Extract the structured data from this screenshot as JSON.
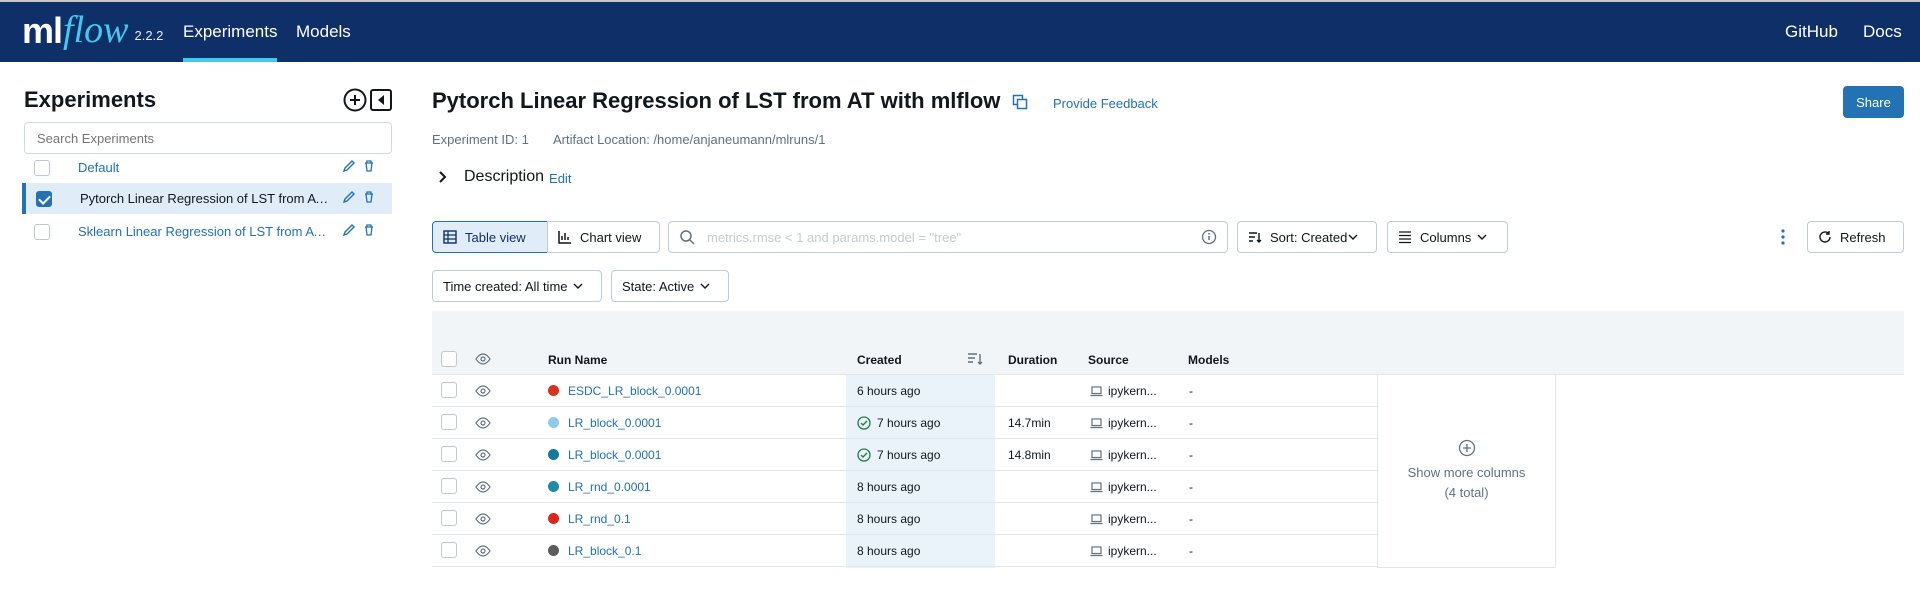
{
  "topbar": {
    "brand_ml": "ml",
    "brand_flow": "flow",
    "version": "2.2.2",
    "nav": {
      "experiments": "Experiments",
      "models": "Models",
      "github": "GitHub",
      "docs": "Docs"
    }
  },
  "sidebar": {
    "title": "Experiments",
    "search_placeholder": "Search Experiments",
    "experiments": [
      {
        "name": "Default",
        "checked": false
      },
      {
        "name": "Pytorch Linear Regression of LST from AT with mlflow",
        "checked": true
      },
      {
        "name": "Sklearn Linear Regression of LST from AT with mlflow",
        "checked": false
      }
    ]
  },
  "main": {
    "title": "Pytorch Linear Regression of LST from AT with mlflow",
    "feedback": "Provide Feedback",
    "share": "Share",
    "experiment_id": "Experiment ID: 1",
    "artifact_location": "Artifact Location: /home/anjaneumann/mlruns/1",
    "description_label": "Description",
    "description_edit": "Edit",
    "toolbar": {
      "table_view": "Table view",
      "chart_view": "Chart view",
      "filter_placeholder": "metrics.rmse < 1 and params.model = \"tree\"",
      "sort": "Sort: Created",
      "columns": "Columns",
      "refresh": "Refresh",
      "time_created": "Time created: All time",
      "state": "State: Active"
    },
    "table": {
      "headers": {
        "run_name": "Run Name",
        "created": "Created",
        "duration": "Duration",
        "source": "Source",
        "models": "Models"
      },
      "rows": [
        {
          "color": "#d8321e",
          "name": "ESDC_LR_block_0.0001",
          "created": "6 hours ago",
          "success": false,
          "duration": "",
          "source": "ipykern...",
          "models": "-"
        },
        {
          "color": "#8ecbe8",
          "name": "LR_block_0.0001",
          "created": "7 hours ago",
          "success": true,
          "duration": "14.7min",
          "source": "ipykern...",
          "models": "-"
        },
        {
          "color": "#12789e",
          "name": "LR_block_0.0001",
          "created": "7 hours ago",
          "success": true,
          "duration": "14.8min",
          "source": "ipykern...",
          "models": "-"
        },
        {
          "color": "#1d8aa8",
          "name": "LR_rnd_0.0001",
          "created": "8 hours ago",
          "success": false,
          "duration": "",
          "source": "ipykern...",
          "models": "-"
        },
        {
          "color": "#e0261a",
          "name": "LR_rnd_0.1",
          "created": "8 hours ago",
          "success": false,
          "duration": "",
          "source": "ipykern...",
          "models": "-"
        },
        {
          "color": "#5c5c5c",
          "name": "LR_block_0.1",
          "created": "8 hours ago",
          "success": false,
          "duration": "",
          "source": "ipykern...",
          "models": "-"
        }
      ],
      "show_more": "Show more columns",
      "show_more_count": "(4 total)"
    }
  },
  "colors": {
    "topbar": "#0e2f67",
    "accent": "#2272b4",
    "brand_flow": "#43c9ed"
  }
}
